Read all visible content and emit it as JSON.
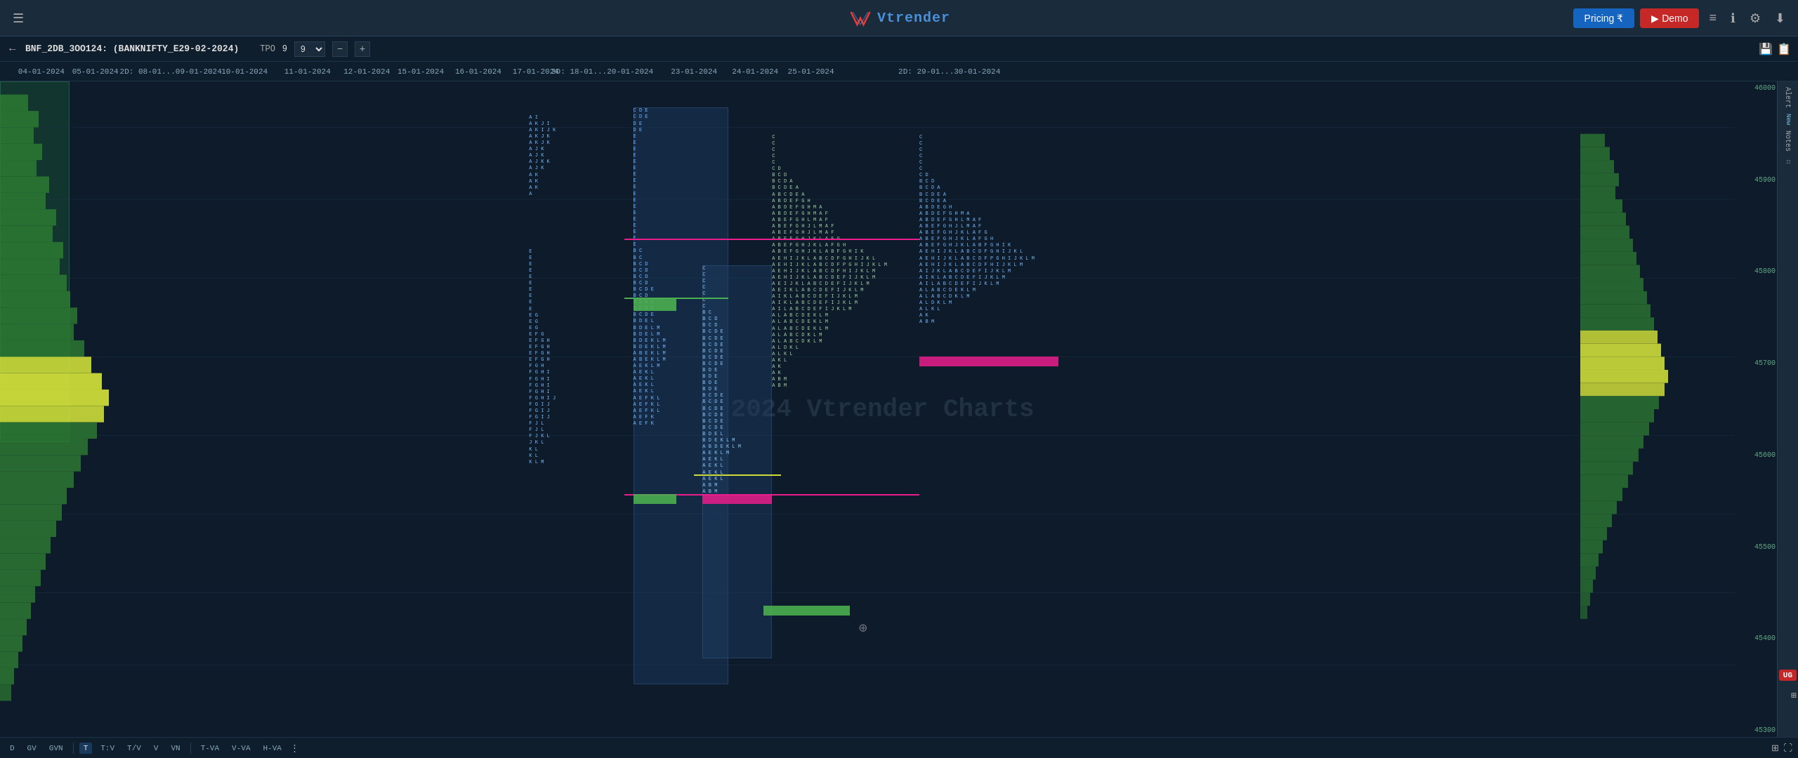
{
  "header": {
    "menu_icon": "☰",
    "logo_text": "Vtrender",
    "pricing_label": "Pricing ₹",
    "demo_label": "▶ Demo",
    "icons": [
      "≡",
      "ℹ",
      "⚙",
      "↓↑"
    ]
  },
  "instrument_bar": {
    "back_icon": "←",
    "instrument_name": "BNF_2DB_3OO124: (BANKNIFTY_E29-02-2024)",
    "tpo_label": "TPO",
    "tpo_value": "9",
    "zoom_minus": "−",
    "zoom_plus": "+",
    "right_icons": [
      "💾",
      "📋"
    ]
  },
  "dates": [
    {
      "label": "04-01-2024",
      "left_pct": 2.3
    },
    {
      "label": "05-01-2024",
      "left_pct": 5.3
    },
    {
      "label": "2D: 08-01...09-01-2024",
      "left_pct": 9.5
    },
    {
      "label": "10-01-2024",
      "left_pct": 13.6
    },
    {
      "label": "11-01-2024",
      "left_pct": 17.1
    },
    {
      "label": "12-01-2024",
      "left_pct": 20.4
    },
    {
      "label": "15-01-2024",
      "left_pct": 23.4
    },
    {
      "label": "16-01-2024",
      "left_pct": 26.6
    },
    {
      "label": "17-01-2024",
      "left_pct": 29.8
    },
    {
      "label": "3D: 18-01...20-01-2024",
      "left_pct": 33.5
    },
    {
      "label": "23-01-2024",
      "left_pct": 38.6
    },
    {
      "label": "24-01-2024",
      "left_pct": 42.0
    },
    {
      "label": "25-01-2024",
      "left_pct": 45.1
    },
    {
      "label": "2D: 29-01...30-01-2024",
      "left_pct": 52.8
    }
  ],
  "price_scale": [
    {
      "value": "46000",
      "top_pct": 7
    },
    {
      "value": "45900",
      "top_pct": 18
    },
    {
      "value": "45800",
      "top_pct": 30
    },
    {
      "value": "45700",
      "top_pct": 42
    },
    {
      "value": "45600",
      "top_pct": 54
    },
    {
      "value": "45500",
      "top_pct": 66
    },
    {
      "value": "45400",
      "top_pct": 78
    },
    {
      "value": "45300",
      "top_pct": 89
    }
  ],
  "watermark": "© 2024 Vtrender Charts",
  "bottom_tabs": [
    {
      "label": "D",
      "active": false
    },
    {
      "label": "GV",
      "active": false
    },
    {
      "label": "GVN",
      "active": false
    },
    {
      "label": "T",
      "active": true
    },
    {
      "label": "T:V",
      "active": false
    },
    {
      "label": "T/V",
      "active": false
    },
    {
      "label": "V",
      "active": false
    },
    {
      "label": "VN",
      "active": false
    },
    {
      "label": "T-VA",
      "active": false
    },
    {
      "label": "V-VA",
      "active": false
    },
    {
      "label": "H-VA",
      "active": false
    }
  ],
  "side_labels": [
    "Alert",
    "New",
    "Notes",
    "UG"
  ],
  "ug_badge": "UG",
  "crosshair_symbol": "⊕"
}
